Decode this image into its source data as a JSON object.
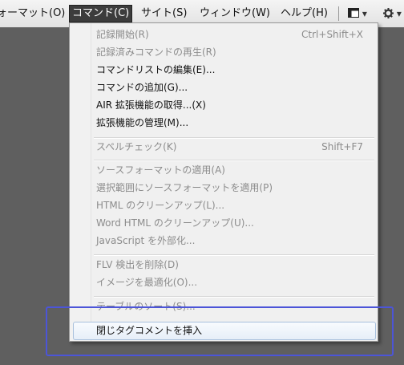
{
  "colors": {
    "menubar_active_bg": "#3c3c3c",
    "menu_bg": "#f0f0f0",
    "disabled_text": "#8c8c8c",
    "highlight_border": "#a8c0dc",
    "annotation_border": "#4c55d8",
    "workspace_bg": "#5f5f5f"
  },
  "menubar": {
    "items": [
      {
        "label": "ォーマット(O)"
      },
      {
        "label": "コマンド(C)"
      },
      {
        "label": "サイト(S)"
      },
      {
        "label": "ウィンドウ(W)"
      },
      {
        "label": "ヘルプ(H)"
      }
    ],
    "tools": {
      "layout_icon": "layout-icon",
      "gear_icon": "gear-icon",
      "chevron": "▾"
    }
  },
  "menu": {
    "items": [
      {
        "label": "記録開始(R)",
        "shortcut": "Ctrl+Shift+X",
        "state": "disabled"
      },
      {
        "label": "記録済みコマンドの再生(R)",
        "shortcut": "",
        "state": "disabled"
      },
      {
        "label": "コマンドリストの編集(E)...",
        "shortcut": "",
        "state": "enabled"
      },
      {
        "label": "コマンドの追加(G)...",
        "shortcut": "",
        "state": "enabled"
      },
      {
        "label": "AIR 拡張機能の取得...(X)",
        "shortcut": "",
        "state": "enabled"
      },
      {
        "label": "拡張機能の管理(M)...",
        "shortcut": "",
        "state": "enabled"
      },
      {
        "label": "スペルチェック(K)",
        "shortcut": "Shift+F7",
        "state": "disabled"
      },
      {
        "label": "ソースフォーマットの適用(A)",
        "shortcut": "",
        "state": "disabled"
      },
      {
        "label": "選択範囲にソースフォーマットを適用(P)",
        "shortcut": "",
        "state": "disabled"
      },
      {
        "label": "HTML のクリーンアップ(L)...",
        "shortcut": "",
        "state": "disabled"
      },
      {
        "label": "Word HTML のクリーンアップ(U)...",
        "shortcut": "",
        "state": "disabled"
      },
      {
        "label": "JavaScript を外部化...",
        "shortcut": "",
        "state": "disabled"
      },
      {
        "label": "FLV 検出を削除(D)",
        "shortcut": "",
        "state": "disabled"
      },
      {
        "label": "イメージを最適化(O)...",
        "shortcut": "",
        "state": "disabled"
      },
      {
        "label": "テーブルのソート(S)...",
        "shortcut": "",
        "state": "disabled"
      },
      {
        "label": "閉じタグコメントを挿入",
        "shortcut": "",
        "state": "highlighted"
      }
    ]
  }
}
